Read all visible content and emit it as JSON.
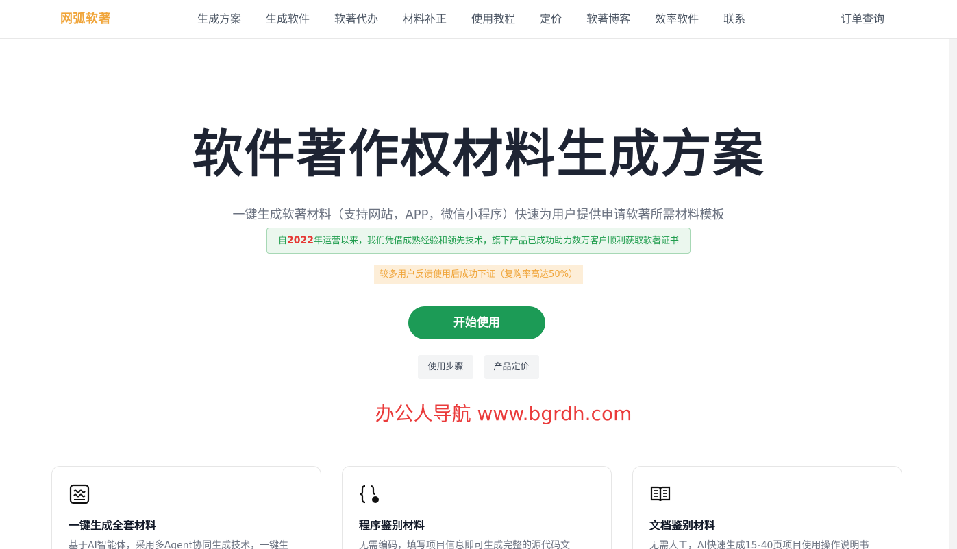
{
  "header": {
    "logo": "网弧软著",
    "nav": [
      "生成方案",
      "生成软件",
      "软著代办",
      "材料补正",
      "使用教程",
      "定价",
      "软著博客",
      "效率软件",
      "联系"
    ],
    "right_link": "订单查询"
  },
  "hero": {
    "title": "软件著作权材料生成方案",
    "subtitle": "一键生成软著材料（支持网站，APP，微信小程序）快速为用户提供申请软著所需材料模板",
    "notice_prefix": "自",
    "notice_year": "2022",
    "notice_rest": "年运营以来，我们凭借成熟经验和领先技术，旗下产品已成功助力数万客户顺利获取软著证书",
    "badge": "较多用户反馈使用后成功下证（复购率高达50%）",
    "cta": "开始使用",
    "sub_buttons": [
      "使用步骤",
      "产品定价"
    ],
    "watermark": "办公人导航 www.bgrdh.com"
  },
  "cards": [
    {
      "icon": "document-wave-icon",
      "title": "一键生成全套材料",
      "desc": "基于AI智能体，采用多Agent协同生成技术，一键生"
    },
    {
      "icon": "code-braces-icon",
      "title": "程序鉴别材料",
      "desc": "无需编码，填写项目信息即可生成完整的源代码文"
    },
    {
      "icon": "open-book-icon",
      "title": "文档鉴别材料",
      "desc": "无需人工，AI快速生成15-40页项目使用操作说明书"
    }
  ],
  "colors": {
    "brand": "#f0a53a",
    "primary_green": "#1c9b56",
    "notice_green": "#1f9d4d",
    "highlight_red": "#e53935",
    "watermark_red": "#ea3b3b"
  }
}
